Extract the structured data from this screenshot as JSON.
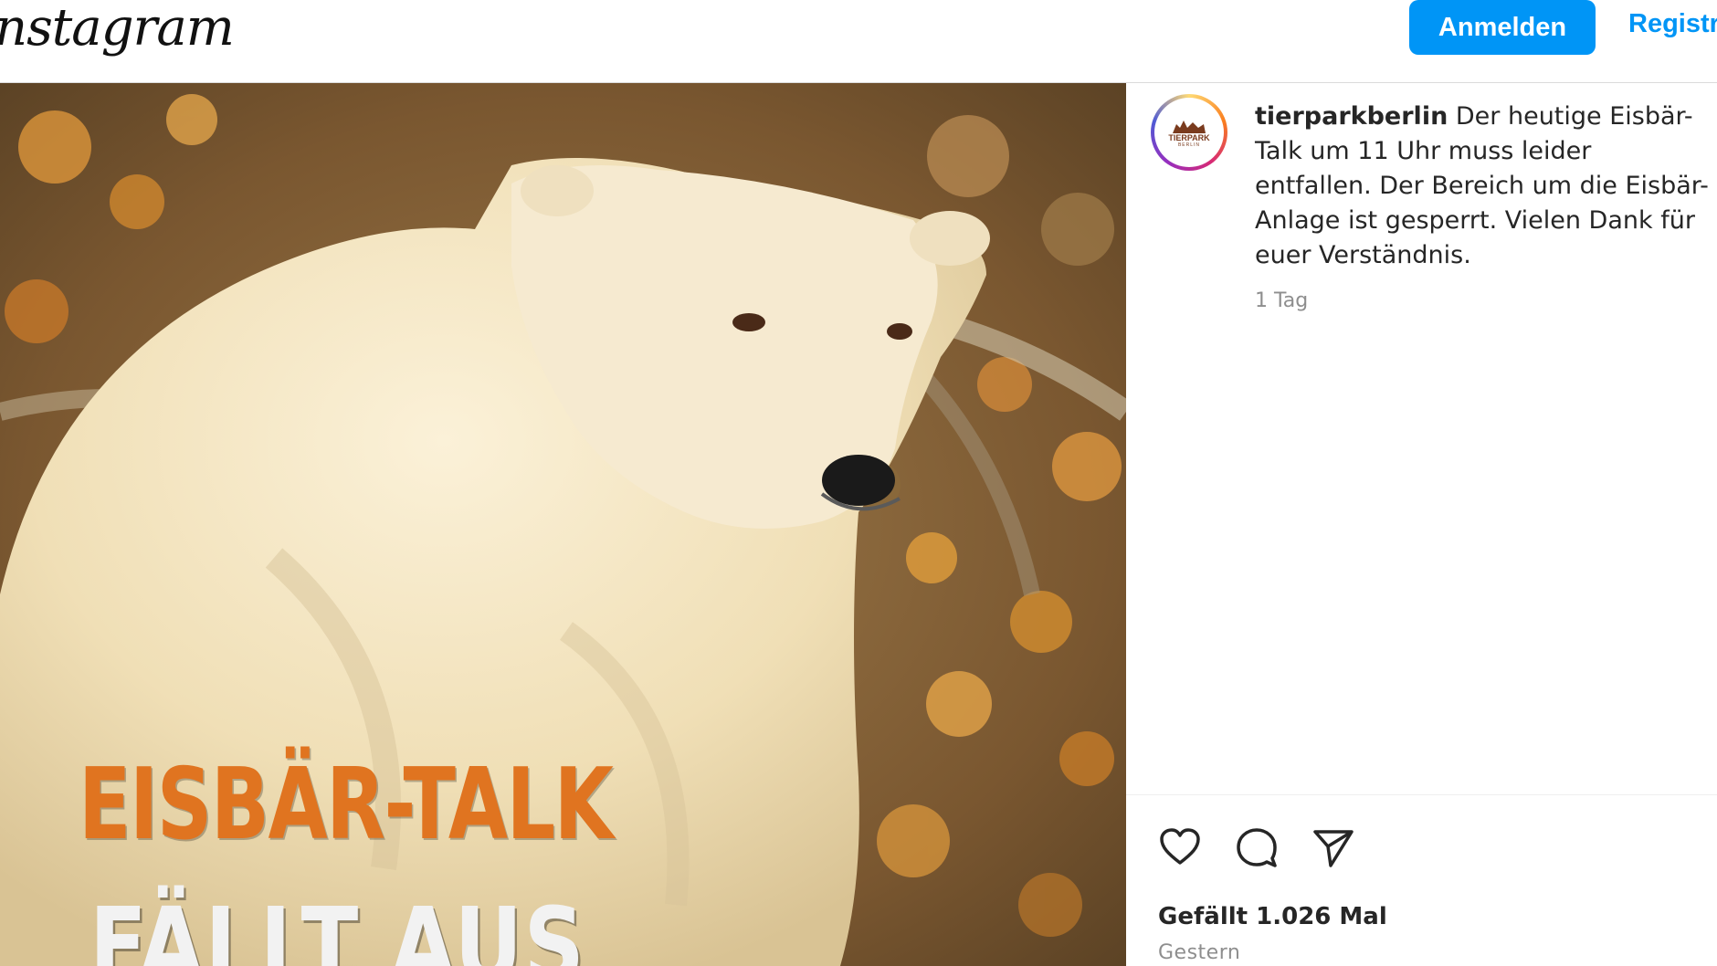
{
  "header": {
    "logo_text": "nstagram",
    "login_label": "Anmelden",
    "register_label": "Registri"
  },
  "post": {
    "image_text_line1": "EISBÄR-TALK",
    "image_text_line2": "FÄLLT AUS",
    "avatar_logo_text": "TIERPARK",
    "avatar_logo_sub": "BERLIN",
    "username": "tierparkberlin",
    "caption": "Der heutige Eisbär-Talk um 11 Uhr muss leider entfallen. Der Bereich um die Eisbär-Anlage ist gesperrt. Vielen Dank für euer Verständnis.",
    "time_ago": "1 Tag",
    "likes": "Gefällt 1.026 Mal",
    "date": "Gestern"
  },
  "icons": [
    "heart-icon",
    "comment-icon",
    "share-icon",
    "bookmark-icon"
  ],
  "colors": {
    "accent": "#0095f6",
    "overlay_orange": "#e07420"
  }
}
